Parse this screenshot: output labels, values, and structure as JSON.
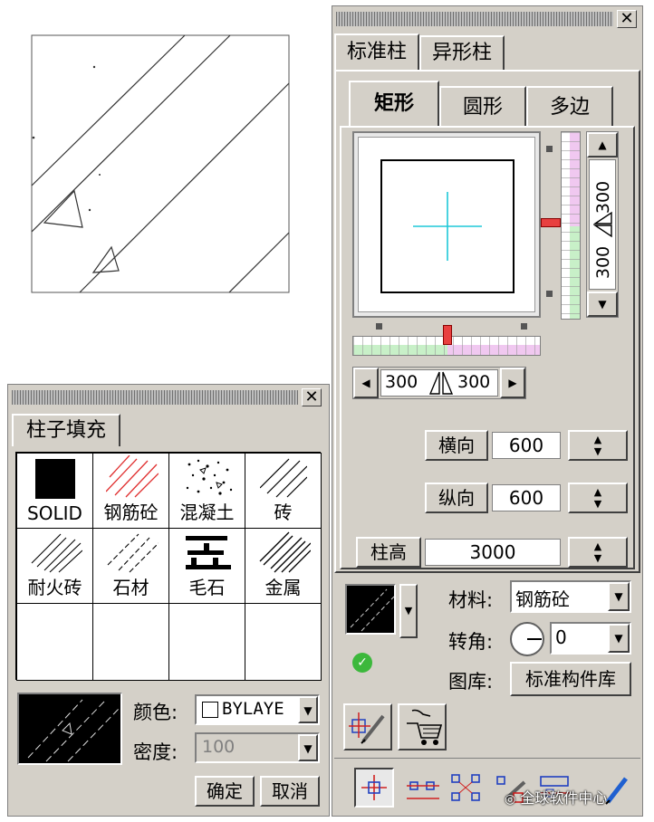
{
  "column_panel": {
    "tabs": [
      "标准柱",
      "异形柱"
    ],
    "shape_tabs": [
      "矩形",
      "圆形",
      "多边"
    ],
    "vertical_ruler_values": [
      "300",
      "300"
    ],
    "horizontal_ruler_values": [
      "300",
      "300"
    ],
    "horizontal": {
      "label": "横向",
      "value": "600"
    },
    "vertical": {
      "label": "纵向",
      "value": "600"
    },
    "height": {
      "label": "柱高",
      "value": "3000"
    },
    "material": {
      "label": "材料:",
      "value": "钢筋砼"
    },
    "rotation": {
      "label": "转角:",
      "value": "0"
    },
    "library": {
      "label": "图库:",
      "button": "标准构件库"
    }
  },
  "fill_panel": {
    "title": "柱子填充",
    "patterns": [
      "SOLID",
      "钢筋砼",
      "混凝土",
      "砖",
      "耐火砖",
      "石材",
      "毛石",
      "金属"
    ],
    "color": {
      "label": "颜色:",
      "value": "BYLAYE"
    },
    "density": {
      "label": "密度:",
      "value": "100"
    },
    "ok": "确定",
    "cancel": "取消"
  },
  "watermark": "全球软件中心"
}
